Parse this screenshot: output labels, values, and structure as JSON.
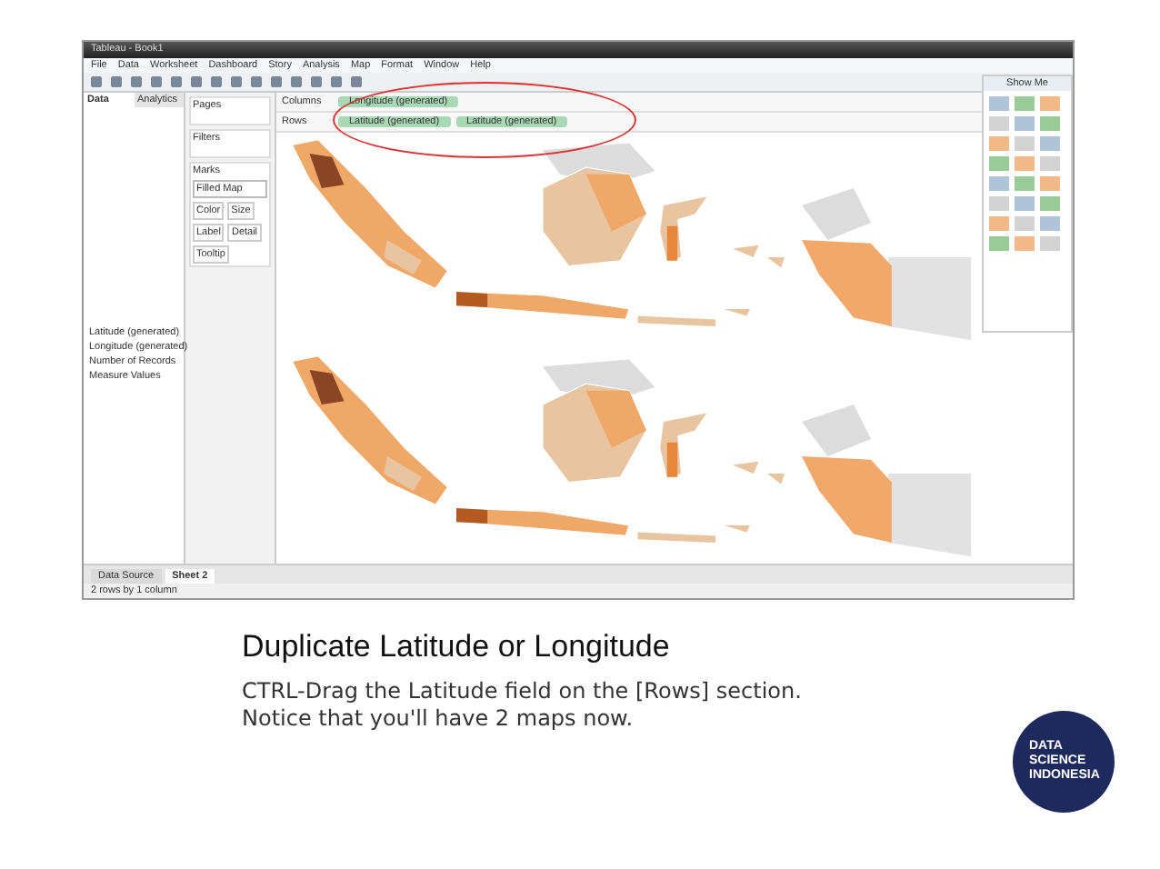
{
  "app": {
    "title": "Tableau - Book1",
    "menu": [
      "File",
      "Data",
      "Worksheet",
      "Dashboard",
      "Story",
      "Analysis",
      "Map",
      "Format",
      "Window",
      "Help"
    ],
    "data_tabs": [
      {
        "label": "Data",
        "selected": true
      },
      {
        "label": "Analytics",
        "selected": false
      }
    ],
    "fields": [
      "Latitude (generated)",
      "Longitude (generated)",
      "Number of Records",
      "Measure Values"
    ],
    "cards": {
      "pages": "Pages",
      "filters": "Filters",
      "marks": "Marks",
      "mark_type": "Filled Map",
      "mark_buttons": [
        "Color",
        "Size",
        "Label",
        "Detail",
        "Tooltip"
      ]
    },
    "shelves": [
      {
        "label": "Columns",
        "pills": [
          "Longitude (generated)"
        ]
      },
      {
        "label": "Rows",
        "pills": [
          "Latitude (generated)",
          "Latitude (generated)"
        ]
      }
    ],
    "show_me": {
      "title": "Show Me"
    },
    "sheet_tabs": [
      {
        "label": "Data Source",
        "selected": false
      },
      {
        "label": "Sheet 2",
        "selected": true
      }
    ],
    "status": "2 rows by 1 column"
  },
  "slide": {
    "title": "Duplicate Latitude or Longitude",
    "body": "CTRL-Drag the Latitude field on the [Rows] section. Notice that you'll have 2 maps now.",
    "logo": [
      "DATA",
      "SCIENCE",
      "INDONESIA"
    ]
  }
}
